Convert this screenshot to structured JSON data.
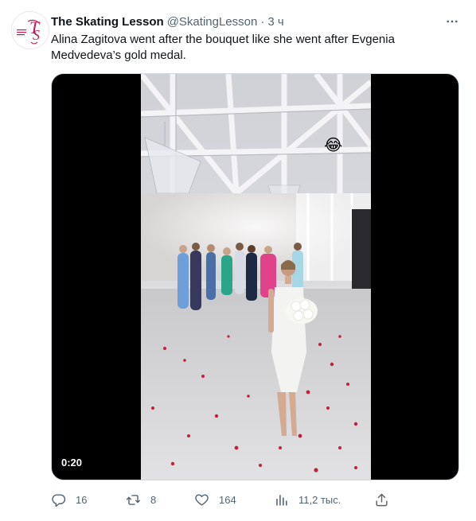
{
  "account": {
    "name": "The Skating Lesson",
    "handle": "@SkatingLesson",
    "separator": "·",
    "time": "3 ч",
    "avatar_icon": "skating-lesson-logo-icon",
    "avatar_lettering": "THE SKATING LESSON"
  },
  "tweet": {
    "text": "Alina Zagitova went after the bouquet like she went after Evgenia Medvedeva’s gold medal."
  },
  "media": {
    "duration": "0:20",
    "emoji": "😂"
  },
  "actions": {
    "replies": "16",
    "retweets": "8",
    "likes": "164",
    "views": "11,2 тыс.",
    "reply_icon": "reply-icon",
    "retweet_icon": "retweet-icon",
    "like_icon": "heart-icon",
    "views_icon": "views-icon",
    "share_icon": "share-icon"
  },
  "colors": {
    "text_primary": "#0f1419",
    "text_secondary": "#536471",
    "logo_pink": "#c2185b"
  }
}
